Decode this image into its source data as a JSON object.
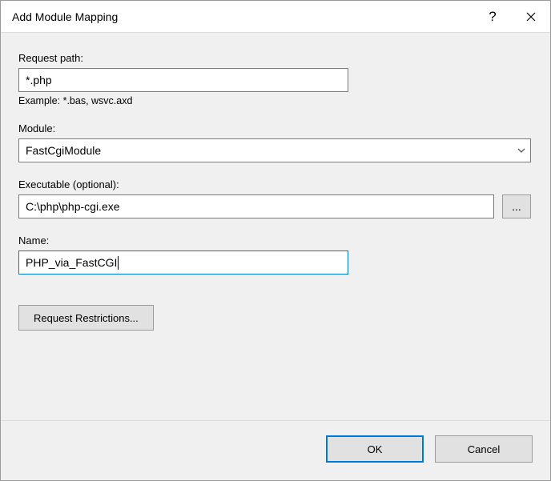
{
  "title": "Add Module Mapping",
  "help_symbol": "?",
  "fields": {
    "request_path": {
      "label": "Request path:",
      "value": "*.php",
      "example": "Example: *.bas, wsvc.axd"
    },
    "module": {
      "label": "Module:",
      "value": "FastCgiModule"
    },
    "executable": {
      "label": "Executable (optional):",
      "value": "C:\\php\\php-cgi.exe",
      "browse_label": "..."
    },
    "name": {
      "label": "Name:",
      "value": "PHP_via_FastCGI"
    }
  },
  "buttons": {
    "restrictions": "Request Restrictions...",
    "ok": "OK",
    "cancel": "Cancel"
  }
}
